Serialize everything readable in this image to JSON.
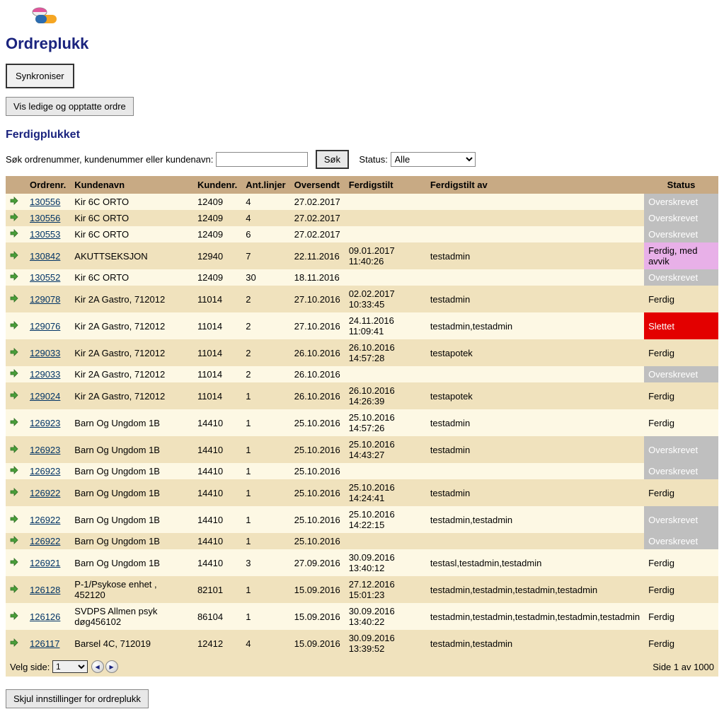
{
  "heading": "Ordreplukk",
  "buttons": {
    "sync": "Synkroniser",
    "toggleLedige": "Vis ledige og opptatte ordre",
    "search": "Søk",
    "hideSettings": "Skjul innstillinger for ordreplukk"
  },
  "section_title": "Ferdigplukket",
  "search": {
    "label": "Søk ordrenummer, kundenummer eller kundenavn:",
    "status_label": "Status:",
    "status_selected": "Alle",
    "value": ""
  },
  "columns": {
    "ordrenr": "Ordrenr.",
    "kundenavn": "Kundenavn",
    "kundenr": "Kundenr.",
    "antlinjer": "Ant.linjer",
    "oversendt": "Oversendt",
    "ferdigstilt": "Ferdigstilt",
    "ferdigstilt_av": "Ferdigstilt av",
    "status": "Status"
  },
  "rows": [
    {
      "ordnr": "130556",
      "kundenavn": "Kir 6C ORTO",
      "kundenr": "12409",
      "ant": "4",
      "oversendt": "27.02.2017",
      "ferdigstilt": "",
      "av": "",
      "status": "Overskrevet",
      "statusStyle": "overskrevet"
    },
    {
      "ordnr": "130556",
      "kundenavn": "Kir 6C ORTO",
      "kundenr": "12409",
      "ant": "4",
      "oversendt": "27.02.2017",
      "ferdigstilt": "",
      "av": "",
      "status": "Overskrevet",
      "statusStyle": "overskrevet"
    },
    {
      "ordnr": "130553",
      "kundenavn": "Kir 6C ORTO",
      "kundenr": "12409",
      "ant": "6",
      "oversendt": "27.02.2017",
      "ferdigstilt": "",
      "av": "",
      "status": "Overskrevet",
      "statusStyle": "overskrevet"
    },
    {
      "ordnr": "130842",
      "kundenavn": "AKUTTSEKSJON",
      "kundenr": "12940",
      "ant": "7",
      "oversendt": "22.11.2016",
      "ferdigstilt": "09.01.2017 11:40:26",
      "av": "testadmin",
      "status": "Ferdig, med avvik",
      "statusStyle": "ferdig-avvik"
    },
    {
      "ordnr": "130552",
      "kundenavn": "Kir 6C ORTO",
      "kundenr": "12409",
      "ant": "30",
      "oversendt": "18.11.2016",
      "ferdigstilt": "",
      "av": "",
      "status": "Overskrevet",
      "statusStyle": "overskrevet"
    },
    {
      "ordnr": "129078",
      "kundenavn": "Kir 2A Gastro, 712012",
      "kundenr": "11014",
      "ant": "2",
      "oversendt": "27.10.2016",
      "ferdigstilt": "02.02.2017 10:33:45",
      "av": "testadmin",
      "status": "Ferdig",
      "statusStyle": "none"
    },
    {
      "ordnr": "129076",
      "kundenavn": "Kir 2A Gastro, 712012",
      "kundenr": "11014",
      "ant": "2",
      "oversendt": "27.10.2016",
      "ferdigstilt": "24.11.2016 11:09:41",
      "av": "testadmin,testadmin",
      "status": "Slettet",
      "statusStyle": "slettet"
    },
    {
      "ordnr": "129033",
      "kundenavn": "Kir 2A Gastro, 712012",
      "kundenr": "11014",
      "ant": "2",
      "oversendt": "26.10.2016",
      "ferdigstilt": "26.10.2016 14:57:28",
      "av": "testapotek",
      "status": "Ferdig",
      "statusStyle": "none"
    },
    {
      "ordnr": "129033",
      "kundenavn": "Kir 2A Gastro, 712012",
      "kundenr": "11014",
      "ant": "2",
      "oversendt": "26.10.2016",
      "ferdigstilt": "",
      "av": "",
      "status": "Overskrevet",
      "statusStyle": "overskrevet"
    },
    {
      "ordnr": "129024",
      "kundenavn": "Kir 2A Gastro, 712012",
      "kundenr": "11014",
      "ant": "1",
      "oversendt": "26.10.2016",
      "ferdigstilt": "26.10.2016 14:26:39",
      "av": "testapotek",
      "status": "Ferdig",
      "statusStyle": "none"
    },
    {
      "ordnr": "126923",
      "kundenavn": "Barn Og Ungdom 1B",
      "kundenr": "14410",
      "ant": "1",
      "oversendt": "25.10.2016",
      "ferdigstilt": "25.10.2016 14:57:26",
      "av": "testadmin",
      "status": "Ferdig",
      "statusStyle": "none"
    },
    {
      "ordnr": "126923",
      "kundenavn": "Barn Og Ungdom 1B",
      "kundenr": "14410",
      "ant": "1",
      "oversendt": "25.10.2016",
      "ferdigstilt": "25.10.2016 14:43:27",
      "av": "testadmin",
      "status": "Overskrevet",
      "statusStyle": "overskrevet"
    },
    {
      "ordnr": "126923",
      "kundenavn": "Barn Og Ungdom 1B",
      "kundenr": "14410",
      "ant": "1",
      "oversendt": "25.10.2016",
      "ferdigstilt": "",
      "av": "",
      "status": "Overskrevet",
      "statusStyle": "overskrevet"
    },
    {
      "ordnr": "126922",
      "kundenavn": "Barn Og Ungdom 1B",
      "kundenr": "14410",
      "ant": "1",
      "oversendt": "25.10.2016",
      "ferdigstilt": "25.10.2016 14:24:41",
      "av": "testadmin",
      "status": "Ferdig",
      "statusStyle": "none"
    },
    {
      "ordnr": "126922",
      "kundenavn": "Barn Og Ungdom 1B",
      "kundenr": "14410",
      "ant": "1",
      "oversendt": "25.10.2016",
      "ferdigstilt": "25.10.2016 14:22:15",
      "av": "testadmin,testadmin",
      "status": "Overskrevet",
      "statusStyle": "overskrevet"
    },
    {
      "ordnr": "126922",
      "kundenavn": "Barn Og Ungdom 1B",
      "kundenr": "14410",
      "ant": "1",
      "oversendt": "25.10.2016",
      "ferdigstilt": "",
      "av": "",
      "status": "Overskrevet",
      "statusStyle": "overskrevet"
    },
    {
      "ordnr": "126921",
      "kundenavn": "Barn Og Ungdom 1B",
      "kundenr": "14410",
      "ant": "3",
      "oversendt": "27.09.2016",
      "ferdigstilt": "30.09.2016 13:40:12",
      "av": "testasl,testadmin,testadmin",
      "status": "Ferdig",
      "statusStyle": "none"
    },
    {
      "ordnr": "126128",
      "kundenavn": "P-1/Psykose enhet , 452120",
      "kundenr": "82101",
      "ant": "1",
      "oversendt": "15.09.2016",
      "ferdigstilt": "27.12.2016 15:01:23",
      "av": "testadmin,testadmin,testadmin,testadmin",
      "status": "Ferdig",
      "statusStyle": "none"
    },
    {
      "ordnr": "126126",
      "kundenavn": "SVDPS Allmen psyk døg456102",
      "kundenr": "86104",
      "ant": "1",
      "oversendt": "15.09.2016",
      "ferdigstilt": "30.09.2016 13:40:22",
      "av": "testadmin,testadmin,testadmin,testadmin,testadmin",
      "status": "Ferdig",
      "statusStyle": "none"
    },
    {
      "ordnr": "126117",
      "kundenavn": "Barsel 4C, 712019",
      "kundenr": "12412",
      "ant": "4",
      "oversendt": "15.09.2016",
      "ferdigstilt": "30.09.2016 13:39:52",
      "av": "testadmin,testadmin",
      "status": "Ferdig",
      "statusStyle": "none"
    }
  ],
  "pager": {
    "label": "Velg side:",
    "selected": "1",
    "info": "Side 1 av 1000"
  }
}
